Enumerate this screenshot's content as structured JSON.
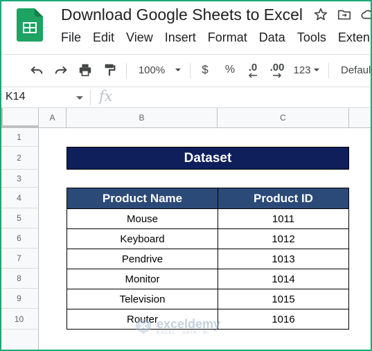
{
  "document": {
    "title": "Download Google Sheets to Excel"
  },
  "menu": {
    "items": [
      "File",
      "Edit",
      "View",
      "Insert",
      "Format",
      "Data",
      "Tools",
      "Exten"
    ]
  },
  "toolbar": {
    "zoom": "100%",
    "currency": "$",
    "percent": "%",
    "decrease_decimal": ".0",
    "increase_decimal": ".00",
    "number_format": "123",
    "font": "Defaul"
  },
  "formula_bar": {
    "cell_ref": "K14",
    "fx": "fx",
    "content": ""
  },
  "grid": {
    "columns": [
      "A",
      "B",
      "C"
    ],
    "rows": [
      "1",
      "2",
      "3",
      "4",
      "5",
      "6",
      "7",
      "8",
      "9",
      "10"
    ]
  },
  "sheet": {
    "dataset_title": "Dataset",
    "headers": [
      "Product Name",
      "Product ID"
    ],
    "rows": [
      [
        "Mouse",
        "1011"
      ],
      [
        "Keyboard",
        "1012"
      ],
      [
        "Pendrive",
        "1013"
      ],
      [
        "Monitor",
        "1014"
      ],
      [
        "Television",
        "1015"
      ],
      [
        "Router",
        "1016"
      ]
    ]
  },
  "watermark": {
    "name": "exceldemy",
    "tagline": "EXCEL · DATA · BI"
  },
  "colors": {
    "sheets_green": "#1ea362",
    "title_fill": "#0f1f5c",
    "header_fill": "#2c4a78",
    "frame": "#19a974"
  }
}
